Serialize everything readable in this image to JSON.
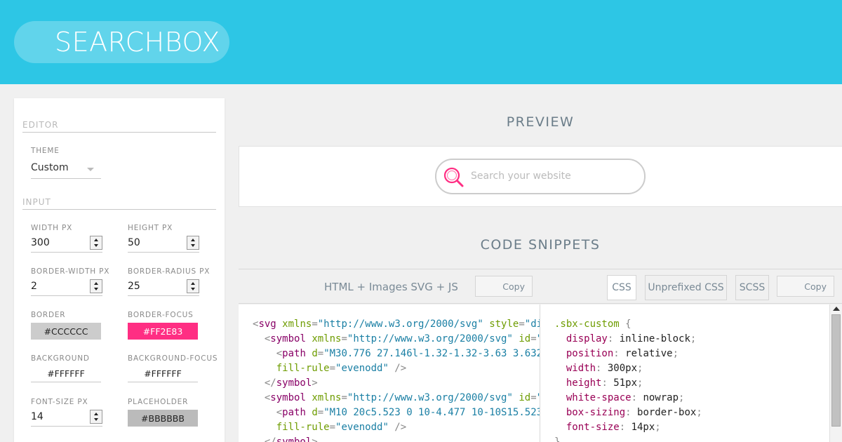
{
  "header": {
    "logo": "SEARCHBOX"
  },
  "sidebar": {
    "editor_title": "EDITOR",
    "theme_label": "THEME",
    "theme_value": "Custom",
    "input_title": "INPUT",
    "fields": {
      "width_label": "WIDTH PX",
      "width_value": "300",
      "height_label": "HEIGHT PX",
      "height_value": "50",
      "border_width_label": "BORDER-WIDTH PX",
      "border_width_value": "2",
      "border_radius_label": "BORDER-RADIUS PX",
      "border_radius_value": "25",
      "border_label": "BORDER",
      "border_value": "#CCCCCC",
      "border_focus_label": "BORDER-FOCUS",
      "border_focus_value": "#FF2E83",
      "background_label": "BACKGROUND",
      "background_value": "#FFFFFF",
      "background_focus_label": "BACKGROUND-FOCUS",
      "background_focus_value": "#FFFFFF",
      "font_size_label": "FONT-SIZE PX",
      "font_size_value": "14",
      "placeholder_label": "PLACEHOLDER",
      "placeholder_value": "#BBBBBB"
    }
  },
  "preview": {
    "title": "PREVIEW",
    "search_placeholder": "Search your website"
  },
  "snippets": {
    "title": "CODE SNIPPETS",
    "html_tab": "HTML + Images SVG + JS",
    "copy_label": "Copy",
    "css_tabs": [
      "CSS",
      "Unprefixed CSS",
      "SCSS"
    ]
  },
  "colors": {
    "header_bg": "#2DC6E5",
    "accent_pink": "#FF2E83",
    "border_swatch": "#CCCCCC",
    "placeholder_swatch": "#BBBBBB"
  },
  "code_left": [
    "<svg xmlns=\"http://www.w3.org/2000/svg\" style=\"di",
    "  <symbol xmlns=\"http://www.w3.org/2000/svg\" id=\"",
    "    <path d=\"M30.776 27.146l-1.32-1.32-3.63 3.632",
    "    fill-rule=\"evenodd\" />",
    "  </symbol>",
    "  <symbol xmlns=\"http://www.w3.org/2000/svg\" id=\"",
    "    <path d=\"M10 20c5.523 0 10-4.477 10-10S15.523",
    "    fill-rule=\"evenodd\" />",
    "  </symbol>"
  ],
  "code_right": [
    ".sbx-custom {",
    "  display: inline-block;",
    "  position: relative;",
    "  width: 300px;",
    "  height: 51px;",
    "  white-space: nowrap;",
    "  box-sizing: border-box;",
    "  font-size: 14px;",
    "}"
  ]
}
